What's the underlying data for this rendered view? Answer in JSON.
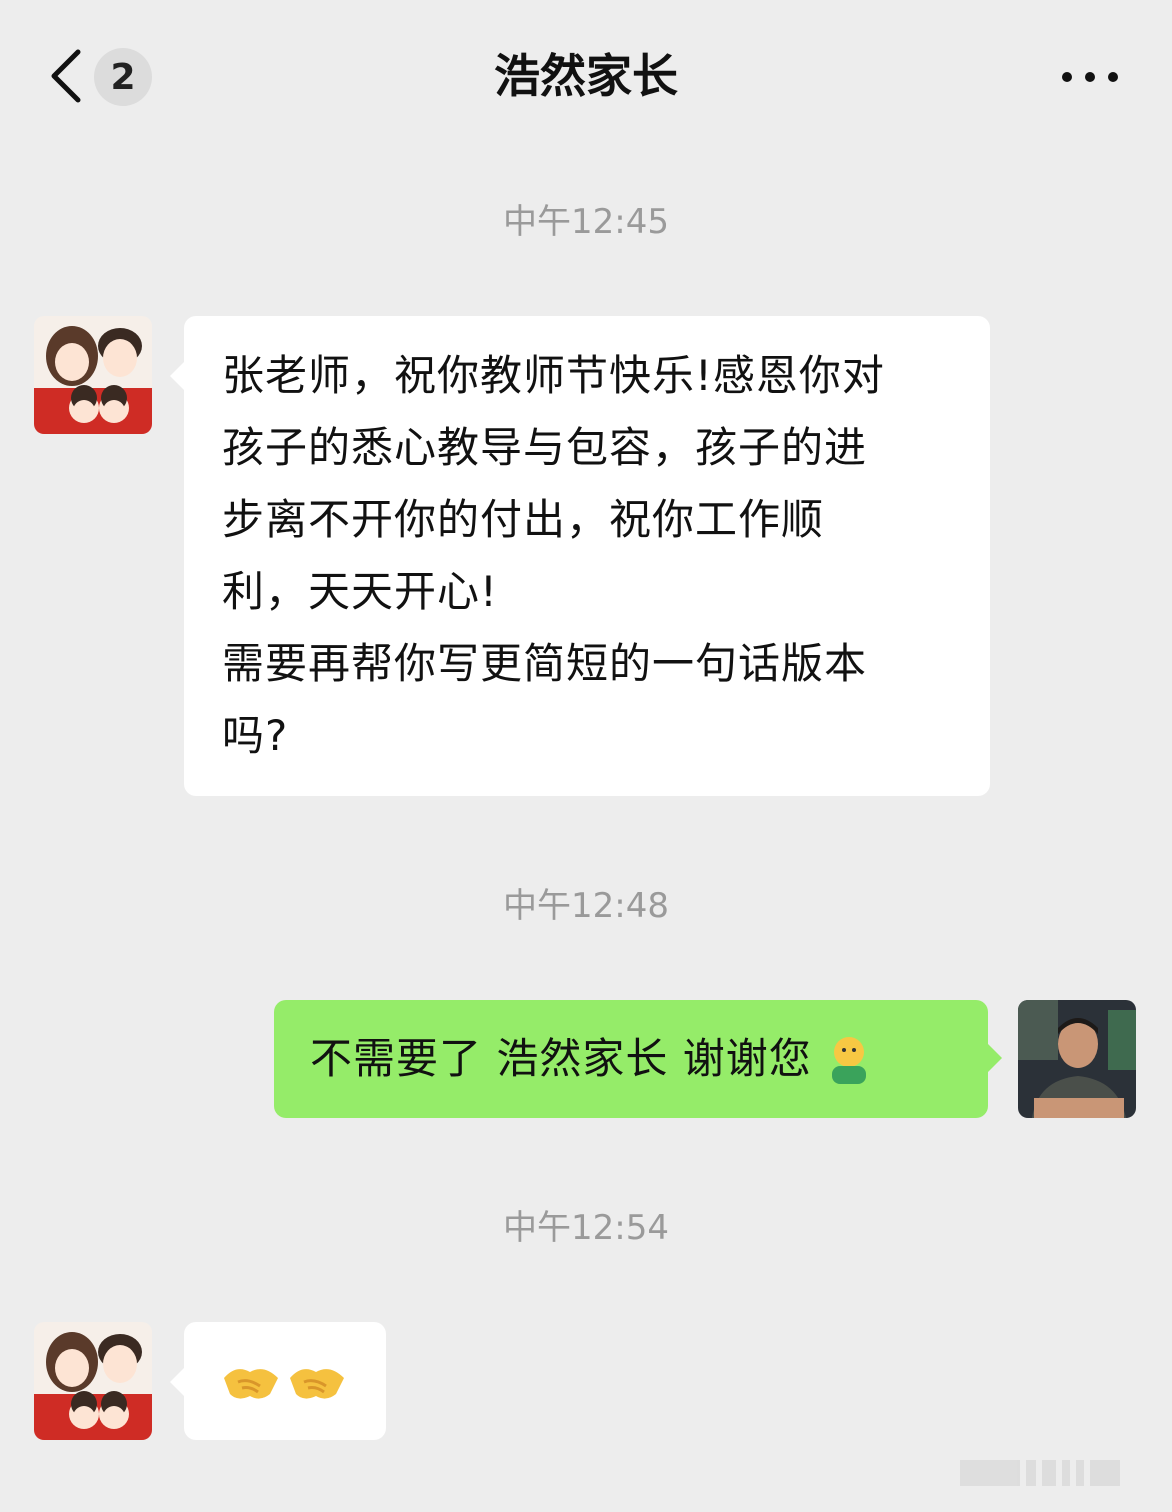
{
  "header": {
    "unread_count": "2",
    "title": "浩然家长"
  },
  "messages": [
    {
      "time": "中午12:45",
      "side": "left",
      "text": "张老师，祝你教师节快乐!感恩你对\n孩子的悉心教导与包容，孩子的进\n步离不开你的付出，祝你工作顺\n利，天天开心!\n需要再帮你写更简短的一句话版本\n吗?"
    },
    {
      "time": "中午12:48",
      "side": "right",
      "text": "不需要了 浩然家长 谢谢您",
      "emoji": "person-emoji"
    },
    {
      "time": "中午12:54",
      "side": "left",
      "text": "",
      "emoji": "handshake-emoji"
    }
  ],
  "colors": {
    "background": "#ededed",
    "incoming_bubble": "#ffffff",
    "outgoing_bubble": "#95ec69",
    "timestamp": "#9a9a9a"
  },
  "icons": [
    "chevron-left-icon",
    "more-dots-icon"
  ]
}
